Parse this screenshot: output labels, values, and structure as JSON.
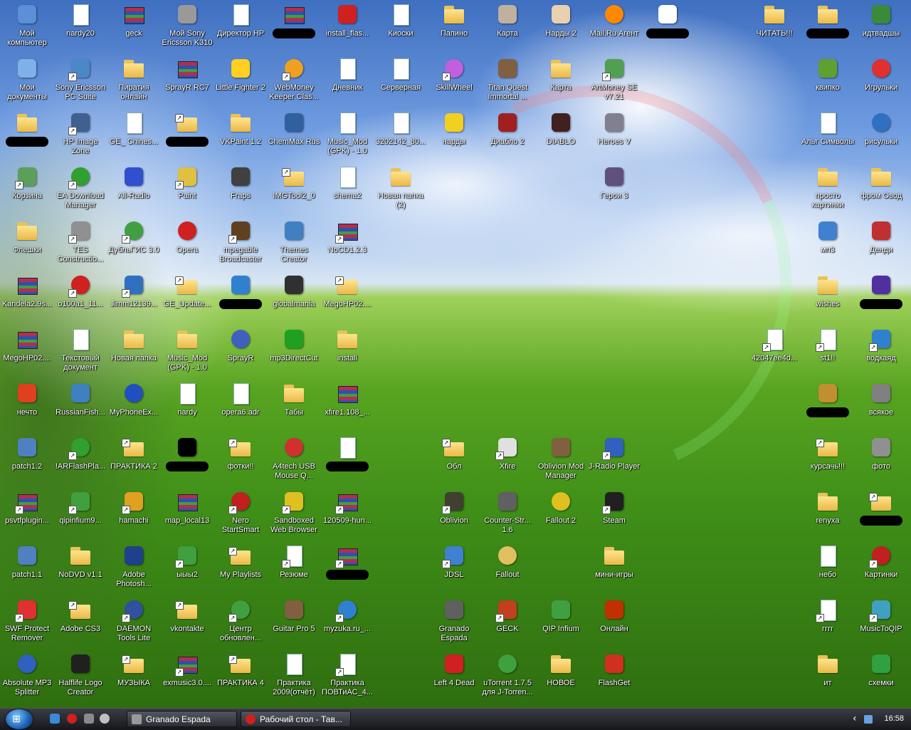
{
  "icons": [
    [
      "Мой компьютер",
      "app",
      "#5b8fd8"
    ],
    [
      "nardy20",
      "doc",
      ""
    ],
    [
      "geck",
      "archive",
      ""
    ],
    [
      "Мой Sony Ericsson K310",
      "app",
      "#999999"
    ],
    [
      "Директор HP",
      "doc",
      ""
    ],
    [
      "",
      "archive",
      ""
    ],
    [
      "install_flas...",
      "app",
      "#d02020"
    ],
    [
      "Киоски",
      "doc",
      ""
    ],
    [
      "Папино",
      "folder",
      ""
    ],
    [
      "Карта",
      "app",
      "#c0b0a0"
    ],
    [
      "Нарды 2",
      "app",
      "#e8d0b0"
    ],
    [
      "Mail.Ru Агент",
      "round",
      "#ff8800"
    ],
    [
      "",
      "app",
      "#ffffff"
    ],
    [
      "ЧИТАТЬ!!!",
      "folder",
      ""
    ],
    [
      "",
      "folder",
      ""
    ],
    [
      "идтвадшы",
      "app",
      "#3a8a3a"
    ],
    [
      "Мои документы",
      "app",
      "#7fb0e8"
    ],
    [
      "Sony Ericsson PC Suite",
      "app",
      "#4a88c8"
    ],
    [
      "Пиратия онлайн",
      "folder",
      ""
    ],
    [
      "SprayR RC7",
      "archive",
      ""
    ],
    [
      "Little Fighter 2",
      "app",
      "#ffd020"
    ],
    [
      "WebMoney Keeper Clas...",
      "round",
      "#f0a020"
    ],
    [
      "Дневник",
      "doc",
      ""
    ],
    [
      "Серверная",
      "doc",
      ""
    ],
    [
      "SkillWheel",
      "round",
      "#c060e0"
    ],
    [
      "Titan Quest Immortal ...",
      "app",
      "#806040"
    ],
    [
      "Карта",
      "folder",
      ""
    ],
    [
      "ArtMoney SE v7.21",
      "app",
      "#50a050"
    ],
    [
      "квипко",
      "app",
      "#60a030"
    ],
    [
      "Игрульки",
      "round",
      "#e03030"
    ],
    [
      "",
      "folder",
      ""
    ],
    [
      "HP Image Zone",
      "app",
      "#406090"
    ],
    [
      "GE_ Chines...",
      "doc",
      ""
    ],
    [
      "",
      "folder",
      ""
    ],
    [
      "VKPaint 1.2",
      "folder",
      ""
    ],
    [
      "ChemMax Rus",
      "app",
      "#3060a0"
    ],
    [
      "Music_Mod (GPK) - 1.0",
      "doc",
      ""
    ],
    [
      "3202142_80...",
      "doc",
      ""
    ],
    [
      "нарды",
      "app",
      "#f0d020"
    ],
    [
      "Диабло 2",
      "app",
      "#a02020"
    ],
    [
      "DIABLO",
      "app",
      "#402020"
    ],
    [
      "Heroes V",
      "app",
      "#808090"
    ],
    [
      "Альт Символы",
      "doc",
      ""
    ],
    [
      "рисульки",
      "round",
      "#3070c0"
    ],
    [
      "Корзина",
      "app",
      "#5aa05a"
    ],
    [
      "EA Download Manager",
      "round",
      "#30a030"
    ],
    [
      "All-Radio",
      "app",
      "#3050d0"
    ],
    [
      "Paint",
      "app",
      "#e0c040"
    ],
    [
      "Fraps",
      "app",
      "#404040"
    ],
    [
      "IMGTool2_0",
      "folder",
      ""
    ],
    [
      "shema2",
      "doc",
      ""
    ],
    [
      "Новая папка (2)",
      "folder",
      ""
    ],
    [
      "Герои 3",
      "app",
      "#605080"
    ],
    [
      "просто картинки",
      "folder",
      ""
    ],
    [
      "фром Овод",
      "folder",
      ""
    ],
    [
      "Флешки",
      "folder",
      ""
    ],
    [
      "TES Constructio...",
      "app",
      "#909090"
    ],
    [
      "ДубльГИС 3.0",
      "round",
      "#40a040"
    ],
    [
      "Opera",
      "round",
      "#d02020"
    ],
    [
      "mpegable Broadcaster",
      "app",
      "#604020"
    ],
    [
      "Themes Creator",
      "app",
      "#4080c0"
    ],
    [
      "NoCD1.2.3",
      "archive",
      ""
    ],
    [
      "мп3",
      "app",
      "#4080d0"
    ],
    [
      "Денди",
      "app",
      "#c03030"
    ],
    [
      "Kandela2.9s...",
      "archive",
      ""
    ],
    [
      "o100a1_11...",
      "round",
      "#d02020"
    ],
    [
      "Jimm12139...",
      "app",
      "#3070c0"
    ],
    [
      "GE_Update...",
      "folder",
      ""
    ],
    [
      "",
      "app",
      "#3080d0"
    ],
    [
      "globalmania",
      "app",
      "#303030"
    ],
    [
      "MegoHP02....",
      "folder",
      ""
    ],
    [
      "wishes",
      "folder",
      ""
    ],
    [
      "",
      "app",
      "#5030a0"
    ],
    [
      "MegoHP02....",
      "archive",
      ""
    ],
    [
      "Текстовый документ",
      "doc",
      ""
    ],
    [
      "Новая папка",
      "folder",
      ""
    ],
    [
      "Music_Mod (GPK) - 1.0",
      "folder",
      ""
    ],
    [
      "SprayR",
      "round",
      "#4060c0"
    ],
    [
      "mp3DirectCut",
      "app",
      "#20a020"
    ],
    [
      "install",
      "folder",
      ""
    ],
    [
      "42047ee4d...",
      "doc",
      ""
    ],
    [
      "st1!!",
      "doc",
      ""
    ],
    [
      "водкаяд",
      "app",
      "#3080d0"
    ],
    [
      "нечто",
      "app",
      "#e04020"
    ],
    [
      "RussianFish...",
      "app",
      "#4080c0"
    ],
    [
      "MyPhoneEx...",
      "round",
      "#2050c0"
    ],
    [
      "nardy",
      "doc",
      ""
    ],
    [
      "opera6.adr",
      "doc",
      ""
    ],
    [
      "Табы",
      "folder",
      ""
    ],
    [
      "xfire1.108_...",
      "archive",
      ""
    ],
    [
      "",
      "app",
      "#c09030"
    ],
    [
      "всякое",
      "app",
      "#808080"
    ],
    [
      "patch1.2",
      "app",
      "#5080c0"
    ],
    [
      "!ARFlashPla...",
      "round",
      "#30a030"
    ],
    [
      "ПРАКТИКА 2",
      "folder",
      ""
    ],
    [
      "",
      "app",
      "#000000"
    ],
    [
      "фотки!!",
      "folder",
      ""
    ],
    [
      "A4tech USB Mouse Q...",
      "round",
      "#d03030"
    ],
    [
      "",
      "doc",
      ""
    ],
    [
      "Обл",
      "folder",
      ""
    ],
    [
      "Xfire",
      "app",
      "#e0e0e0"
    ],
    [
      "Oblivion Mod Manager",
      "app",
      "#806040"
    ],
    [
      "J-Radio Player",
      "app",
      "#3060c0"
    ],
    [
      "курсачь!!!",
      "folder",
      ""
    ],
    [
      "фото",
      "app",
      "#909090"
    ],
    [
      "psvtfplugin...",
      "archive",
      ""
    ],
    [
      "qipinfium9...",
      "app",
      "#40a040"
    ],
    [
      "hamachi",
      "app",
      "#e0a020"
    ],
    [
      "map_local13",
      "archive",
      ""
    ],
    [
      "Nero StartSmart",
      "round",
      "#c02020"
    ],
    [
      "Sandboxed Web Browser",
      "app",
      "#e0c020"
    ],
    [
      "120509-hun...",
      "archive",
      ""
    ],
    [
      "Oblivion",
      "app",
      "#404030"
    ],
    [
      "Counter-Str... 1.6",
      "app",
      "#606060"
    ],
    [
      "Fallout 2",
      "round",
      "#e0c020"
    ],
    [
      "Steam",
      "app",
      "#202020"
    ],
    [
      "renyxa",
      "folder",
      ""
    ],
    [
      "",
      "folder",
      ""
    ],
    [
      "patch1.1",
      "app",
      "#5080c0"
    ],
    [
      "NoDVD v1.1",
      "folder",
      ""
    ],
    [
      "Adobe Photosh...",
      "app",
      "#1f3f8f"
    ],
    [
      "ыыы2",
      "app",
      "#40a040"
    ],
    [
      "My Playlists",
      "folder",
      ""
    ],
    [
      "Резюме",
      "doc",
      ""
    ],
    [
      "",
      "archive",
      ""
    ],
    [
      "JDSL",
      "app",
      "#4080d0"
    ],
    [
      "Fallout",
      "round",
      "#e0c060"
    ],
    [
      "мини-игры",
      "folder",
      ""
    ],
    [
      "небо",
      "doc",
      ""
    ],
    [
      "Картинки",
      "round",
      "#c02020"
    ],
    [
      "SWF Protect Remover",
      "app",
      "#e03030"
    ],
    [
      "Adobe CS3",
      "folder",
      ""
    ],
    [
      "DAEMON Tools Lite",
      "round",
      "#3050a0"
    ],
    [
      "vkontakte",
      "folder",
      ""
    ],
    [
      "Центр обновлен...",
      "round",
      "#40a040"
    ],
    [
      "Guitar Pro 5",
      "app",
      "#806040"
    ],
    [
      "myzuka.ru_...",
      "round",
      "#3080d0"
    ],
    [
      "Granado Espada",
      "app",
      "#606060"
    ],
    [
      "GECK",
      "app",
      "#c04020"
    ],
    [
      "QIP Infium",
      "app",
      "#40a040"
    ],
    [
      "Онлайн",
      "app",
      "#c03000"
    ],
    [
      "гггг",
      "doc",
      ""
    ],
    [
      "MusicToQIP",
      "app",
      "#40a0c0"
    ],
    [
      "Absolute MP3 Splitter",
      "round",
      "#3060c0"
    ],
    [
      "Halflife Logo Creator",
      "app",
      "#202020"
    ],
    [
      "МУЗЫКА",
      "folder",
      ""
    ],
    [
      "exmusic3.0....",
      "archive",
      ""
    ],
    [
      "ПРАКТИКА 4",
      "folder",
      ""
    ],
    [
      "Практика 2009(отчёт)",
      "doc",
      ""
    ],
    [
      "Практика ПОВТиАС_4...",
      "doc",
      ""
    ],
    [
      "Left 4 Dead",
      "app",
      "#d02020"
    ],
    [
      "uTorrent 1.7.5 для J-Torren...",
      "round",
      "#40a040"
    ],
    [
      "НОВОЕ",
      "folder",
      ""
    ],
    [
      "FlashGet",
      "app",
      "#d03020"
    ],
    [
      "ит",
      "folder",
      ""
    ],
    [
      "схемки",
      "app",
      "#30a040"
    ]
  ],
  "taskbar": {
    "tasks": [
      "Granado Espada",
      "Рабочий стол - Тав..."
    ],
    "clock": "16:58",
    "tray_arrow": "‹"
  }
}
